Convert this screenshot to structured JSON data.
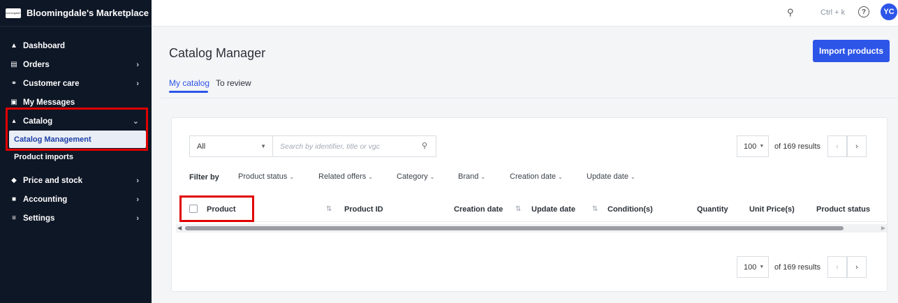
{
  "brand": {
    "logo_text": "bloomingdale's",
    "name": "Bloomingdale's Marketplace"
  },
  "topbar": {
    "shortcut": "Ctrl + k",
    "help": "?",
    "avatar": "YC"
  },
  "sidebar": {
    "items": [
      {
        "label": "Dashboard",
        "icon": "home-icon"
      },
      {
        "label": "Orders",
        "icon": "clipboard-icon"
      },
      {
        "label": "Customer care",
        "icon": "headset-icon"
      },
      {
        "label": "My Messages",
        "icon": "message-icon"
      },
      {
        "label": "Catalog",
        "icon": "catalog-icon"
      },
      {
        "label": "Catalog Management"
      },
      {
        "label": "Product imports"
      },
      {
        "label": "Price and stock",
        "icon": "tag-icon"
      },
      {
        "label": "Accounting",
        "icon": "accounting-icon"
      },
      {
        "label": "Settings",
        "icon": "settings-icon"
      }
    ]
  },
  "page": {
    "title": "Catalog Manager",
    "import_label": "Import products"
  },
  "tabs": [
    {
      "label": "My catalog"
    },
    {
      "label": "To review"
    }
  ],
  "toolbar": {
    "scope_value": "All",
    "search_placeholder": "Search by identifier, title or vgc",
    "page_size": "100",
    "results": "of 169 results"
  },
  "filters": {
    "label": "Filter by",
    "items": [
      "Product status",
      "Related offers",
      "Category",
      "Brand",
      "Creation date",
      "Update date"
    ]
  },
  "columns": [
    "Product",
    "Product ID",
    "Creation date",
    "Update date",
    "Condition(s)",
    "Quantity",
    "Unit Price(s)",
    "Product status"
  ],
  "colors": {
    "accent": "#2d55e8",
    "sidebar_bg": "#0e1726",
    "highlight": "#e00000"
  }
}
